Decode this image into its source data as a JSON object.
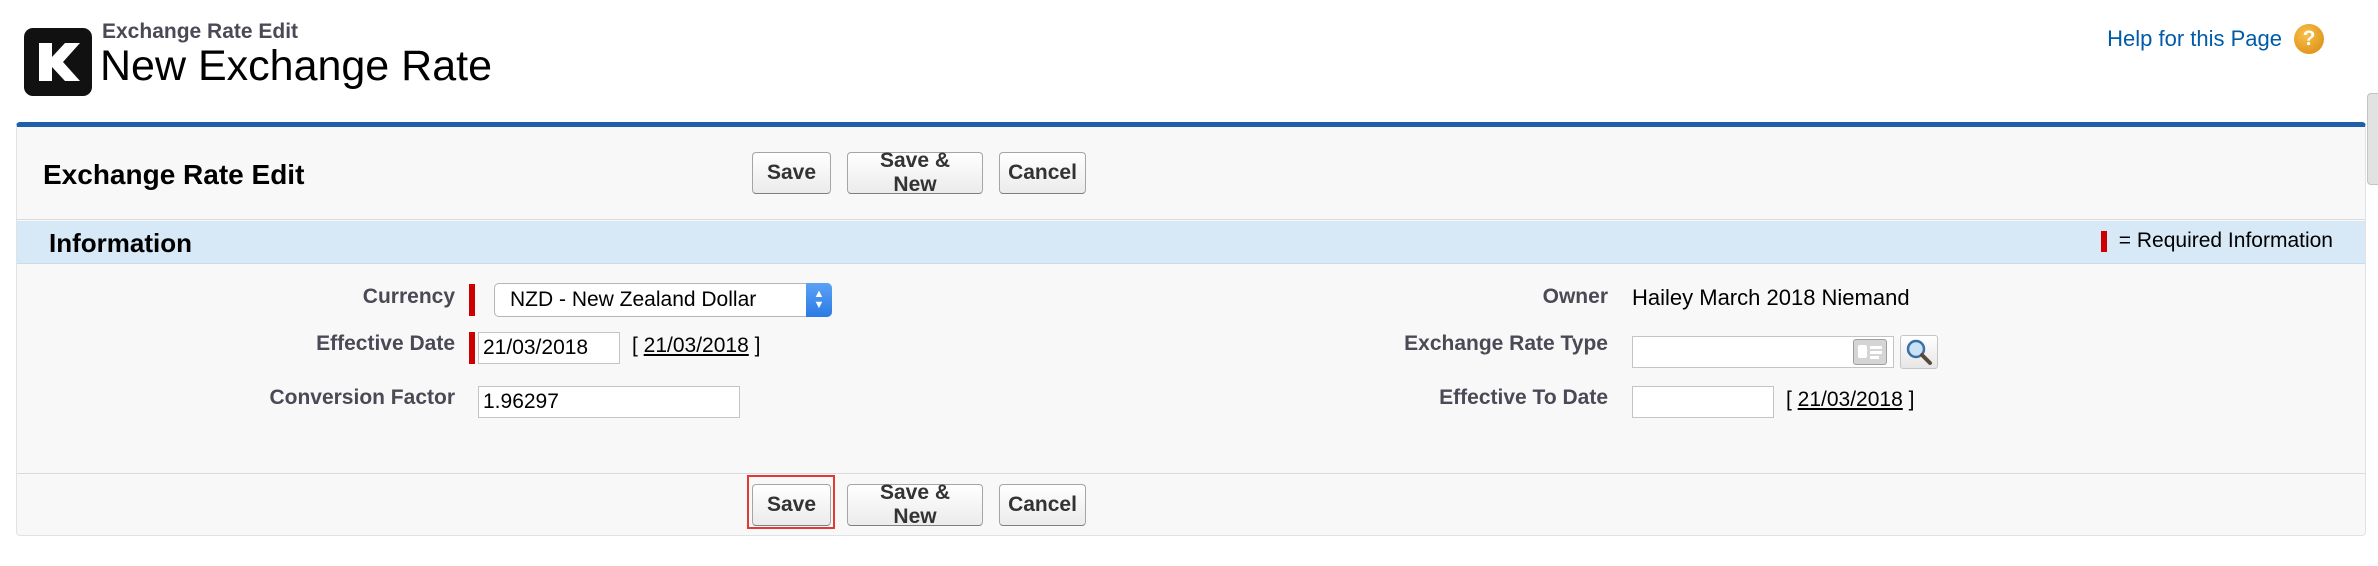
{
  "header": {
    "subtitle": "Exchange Rate Edit",
    "title": "New Exchange Rate",
    "logo_letter": "K",
    "help_link": "Help for this Page",
    "help_icon_glyph": "?"
  },
  "panel": {
    "title": "Exchange Rate Edit",
    "buttons": {
      "save": "Save",
      "save_new": "Save & New",
      "cancel": "Cancel"
    }
  },
  "section": {
    "title": "Information",
    "required_legend": "= Required Information"
  },
  "fields": {
    "currency": {
      "label": "Currency",
      "value": "NZD - New Zealand Dollar"
    },
    "effective_date": {
      "label": "Effective Date",
      "value": "21/03/2018",
      "link": "21/03/2018"
    },
    "conversion_factor": {
      "label": "Conversion Factor",
      "value": "1.96297"
    },
    "owner": {
      "label": "Owner",
      "value": "Hailey March 2018 Niemand"
    },
    "exchange_rate_type": {
      "label": "Exchange Rate Type",
      "value": ""
    },
    "effective_to_date": {
      "label": "Effective To Date",
      "value": "",
      "link": "21/03/2018"
    }
  },
  "colors": {
    "brand_blue": "#1f5fa8",
    "section_bg": "#d7e9f6",
    "required_red": "#cc0000",
    "help_link": "#015ba7",
    "focus_highlight": "#e03a32"
  }
}
